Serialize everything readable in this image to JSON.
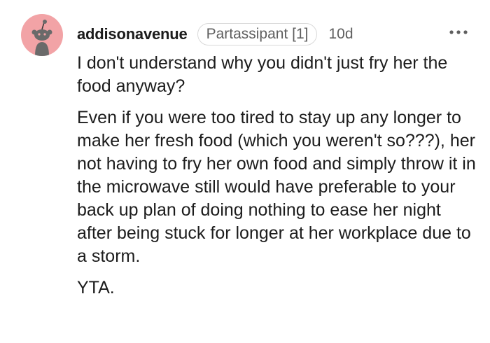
{
  "comment": {
    "username": "addisonavenue",
    "flair": "Partassipant [1]",
    "timestamp": "10d",
    "paragraphs": [
      "I don't understand why you didn't just fry her the food anyway?",
      "Even if you were too tired to stay up any longer to make her fresh food (which you weren't so???), her not having to fry her own food and simply throw it in the microwave still would have preferable to your back up plan of doing nothing to ease her night after being stuck for longer at her workplace due to a storm.",
      "YTA."
    ],
    "avatar_color": "#f2a3a6",
    "more_icon": "more-options-icon"
  }
}
